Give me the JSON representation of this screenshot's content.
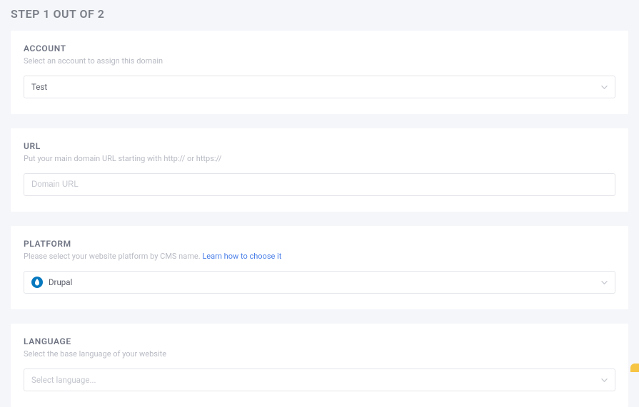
{
  "page_title": "STEP 1 OUT OF 2",
  "account": {
    "label": "ACCOUNT",
    "help": "Select an account to assign this domain",
    "value": "Test"
  },
  "url": {
    "label": "URL",
    "help": "Put your main domain URL starting with http:// or https://",
    "placeholder": "Domain URL"
  },
  "platform": {
    "label": "PLATFORM",
    "help_prefix": "Please select your website platform by CMS name.  ",
    "help_link": "Learn how to choose it",
    "value": "Drupal"
  },
  "language": {
    "label": "LANGUAGE",
    "help": "Select the base language of your website",
    "placeholder": "Select language..."
  }
}
